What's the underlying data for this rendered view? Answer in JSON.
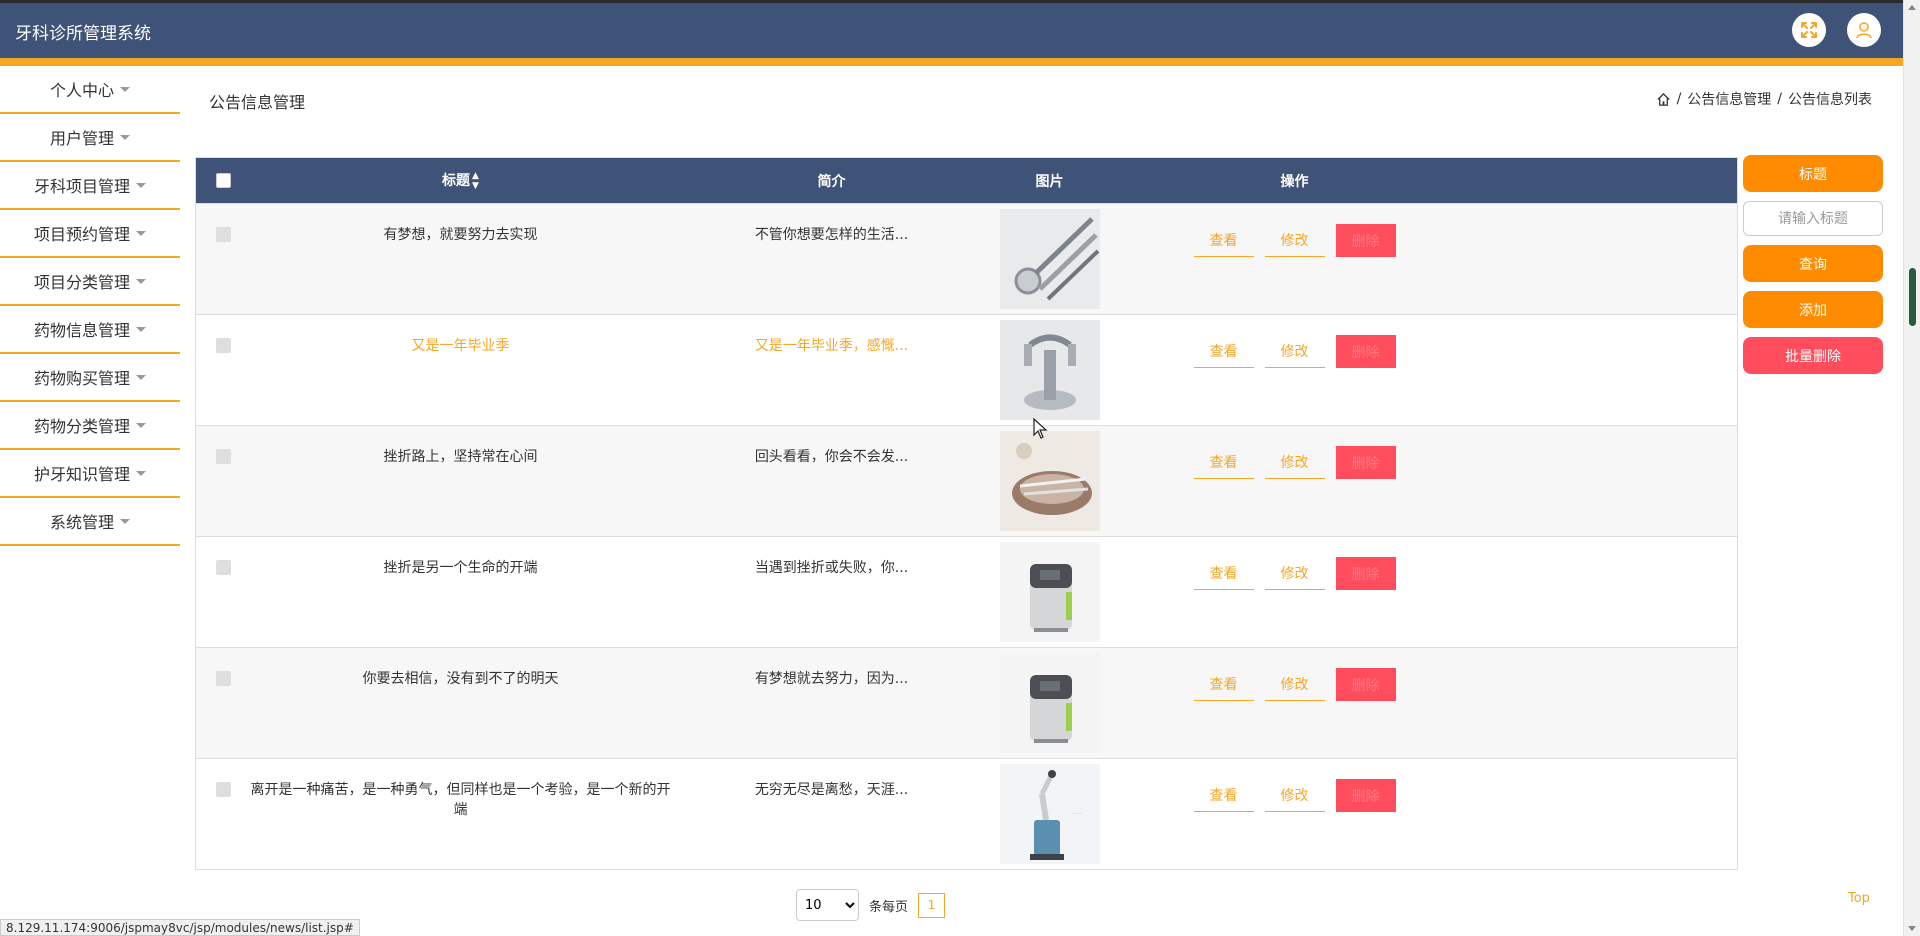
{
  "app": {
    "title": "牙科诊所管理系统",
    "accent_color": "#f5a623",
    "header_color": "#3f5277",
    "header_icons": [
      "fullscreen-icon",
      "user-icon"
    ]
  },
  "sidebar": {
    "items": [
      {
        "label": "个人中心"
      },
      {
        "label": "用户管理"
      },
      {
        "label": "牙科项目管理"
      },
      {
        "label": "项目预约管理"
      },
      {
        "label": "项目分类管理"
      },
      {
        "label": "药物信息管理"
      },
      {
        "label": "药物购买管理"
      },
      {
        "label": "药物分类管理"
      },
      {
        "label": "护牙知识管理"
      },
      {
        "label": "系统管理"
      }
    ]
  },
  "page": {
    "title": "公告信息管理",
    "breadcrumb": [
      "公告信息管理",
      "公告信息列表"
    ],
    "breadcrumb_sep": "/"
  },
  "table": {
    "columns": {
      "title": "标题",
      "desc": "简介",
      "image": "图片",
      "ops": "操作"
    },
    "rows": [
      {
        "title": "有梦想，就要努力去实现",
        "desc": "不管你想要怎样的生活...",
        "image": "dental-mirror-tools"
      },
      {
        "title": "又是一年毕业季",
        "desc": "又是一年毕业季，感慨...",
        "image": "dental-faucet-unit",
        "highlight": true
      },
      {
        "title": "挫折路上，坚持常在心间",
        "desc": "回头看看，你会不会发...",
        "image": "dental-instruments-tray"
      },
      {
        "title": "挫折是另一个生命的开端",
        "desc": "当遇到挫折或失败，你...",
        "image": "dental-device-cabinet"
      },
      {
        "title": "你要去相信，没有到不了的明天",
        "desc": "有梦想就去努力，因为...",
        "image": "dental-device-cabinet"
      },
      {
        "title": "离开是一种痛苦，是一种勇气，但同样也是一个考验，是一个新的开端",
        "desc": "无穷无尽是离愁，天涯...",
        "image": "dental-robot-arm"
      }
    ],
    "ops": {
      "view": "查看",
      "edit": "修改",
      "delete": "删除"
    }
  },
  "panel": {
    "title_button": "标题",
    "search_placeholder": "请输入标题",
    "query_button": "查询",
    "add_button": "添加",
    "batch_delete_button": "批量删除"
  },
  "pager": {
    "page_size": "10",
    "page_size_options": [
      "10"
    ],
    "per_page_label": "条每页",
    "current_page": "1"
  },
  "to_top": "Top",
  "status_url": "8.129.11.174:9006/jspmay8vc/jsp/modules/news/list.jsp#"
}
